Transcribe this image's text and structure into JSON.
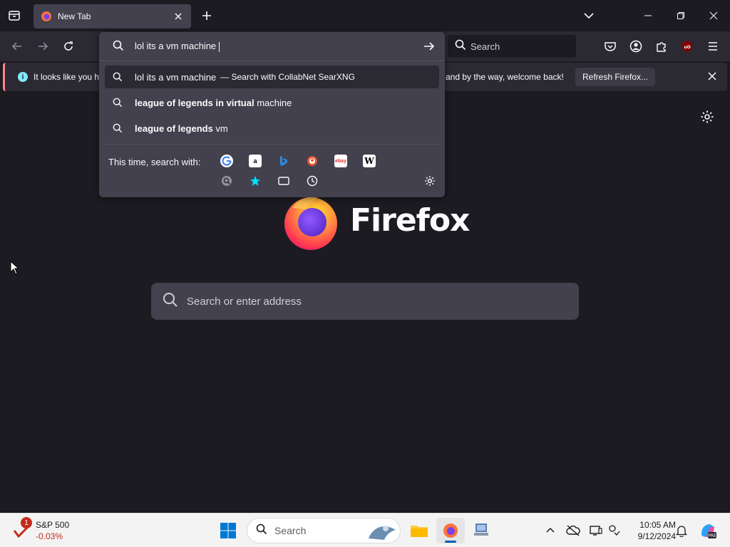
{
  "tabs": [
    {
      "title": "New Tab"
    }
  ],
  "toolbar": {
    "search_placeholder": "Search"
  },
  "urlbar": {
    "input_value": "lol its a vm machine",
    "results": [
      {
        "text": "lol its a vm machine",
        "action": "— Search with CollabNet SearXNG",
        "selected": true
      },
      {
        "bold": "league of legends in virtual",
        "rest": " machine"
      },
      {
        "bold": "league of legends",
        "rest": " vm"
      }
    ],
    "one_off_label": "This time, search with:",
    "engines": [
      "google-icon",
      "amazon-icon",
      "bing-icon",
      "duckduckgo-icon",
      "ebay-icon",
      "wikipedia-icon"
    ],
    "modes": [
      "searxng-icon",
      "bookmarks-icon",
      "tabs-icon",
      "history-icon"
    ]
  },
  "notification": {
    "text_left": "It looks like you ha",
    "text_right": "and by the way, welcome back!",
    "button": "Refresh Firefox..."
  },
  "newtab": {
    "wordmark": "Firefox",
    "search_placeholder": "Search or enter address"
  },
  "taskbar": {
    "widget_title": "S&P 500",
    "widget_value": "-0.03%",
    "widget_badge": "1",
    "search_label": "Search",
    "time": "10:05 AM",
    "date": "9/12/2024"
  },
  "colors": {
    "accent_bar": "#ff848b",
    "widget_negative": "#c42b1c"
  }
}
